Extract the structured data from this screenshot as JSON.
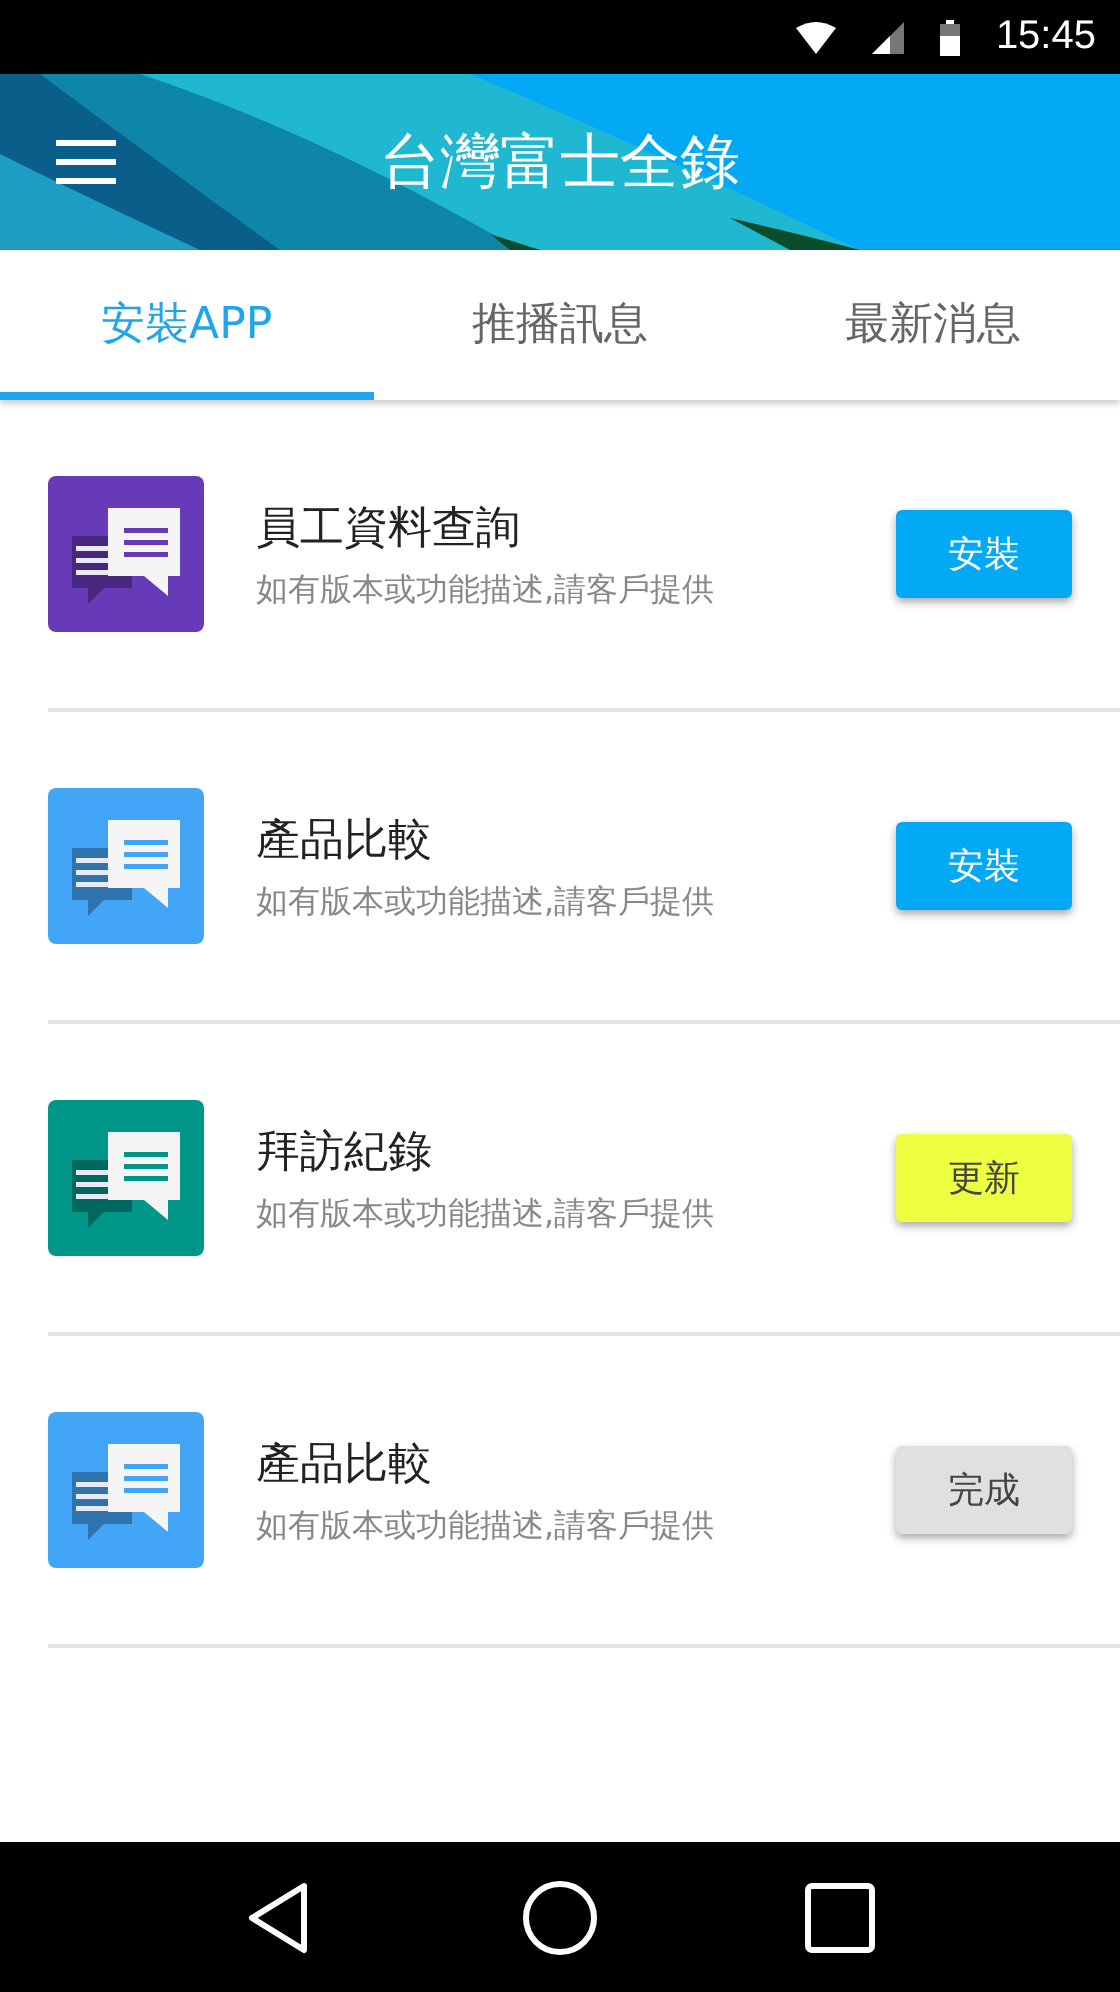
{
  "status_bar": {
    "time": "15:45"
  },
  "header": {
    "title": "台灣富士全錄"
  },
  "tabs": [
    {
      "label": "安裝APP",
      "selected": true
    },
    {
      "label": "推播訊息",
      "selected": false
    },
    {
      "label": "最新消息",
      "selected": false
    }
  ],
  "apps": [
    {
      "name": "員工資料查詢",
      "description": "如有版本或功能描述,請客戶提供",
      "color": "#673ab7",
      "action": {
        "kind": "install",
        "label": "安裝"
      }
    },
    {
      "name": "產品比較",
      "description": "如有版本或功能描述,請客戶提供",
      "color": "#42a5f5",
      "action": {
        "kind": "install",
        "label": "安裝"
      }
    },
    {
      "name": "拜訪紀錄",
      "description": "如有版本或功能描述,請客戶提供",
      "color": "#009688",
      "action": {
        "kind": "update",
        "label": "更新"
      }
    },
    {
      "name": "產品比較",
      "description": "如有版本或功能描述,請客戶提供",
      "color": "#42a5f5",
      "action": {
        "kind": "done",
        "label": "完成"
      }
    }
  ]
}
